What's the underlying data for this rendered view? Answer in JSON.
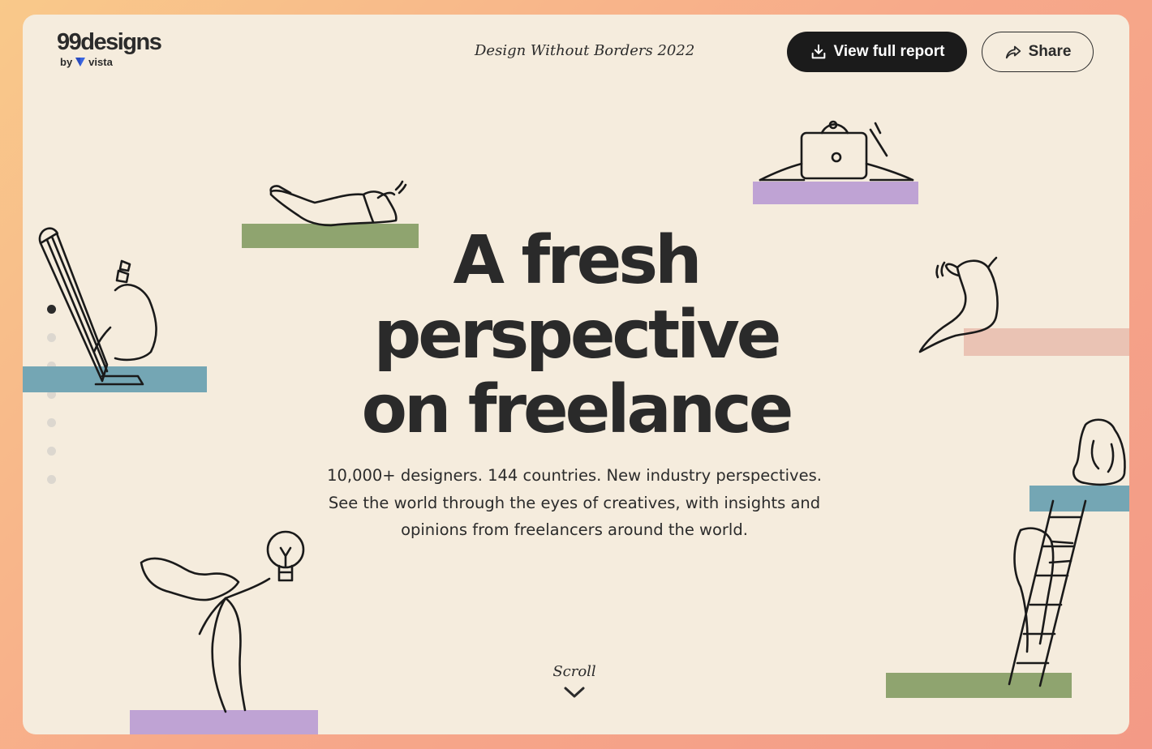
{
  "logo": {
    "main": "99designs",
    "by": "by",
    "brand": "vista"
  },
  "header": {
    "title": "Design Without Borders 2022"
  },
  "buttons": {
    "report": "View full report",
    "share": "Share"
  },
  "hero": {
    "title_lines": [
      "A fresh",
      "perspective",
      "on freelance"
    ],
    "subtitle_lines": [
      "10,000+ designers. 144 countries. New industry perspectives.",
      "See the world through the eyes of creatives, with insights and",
      "opinions from freelancers around the world."
    ]
  },
  "scroll": {
    "label": "Scroll"
  },
  "nav_dots": {
    "count": 7,
    "active_index": 0
  },
  "colors": {
    "background": "#f5ecdd",
    "green_block": "#8fa46f",
    "purple_block": "#bfa3d4",
    "blue_block": "#74a6b4",
    "pink_block": "#eac3b4",
    "dark": "#1b1b1b"
  },
  "icons": [
    "download-icon",
    "share-arrow-icon",
    "chevron-down-icon",
    "vista-mark-icon"
  ]
}
